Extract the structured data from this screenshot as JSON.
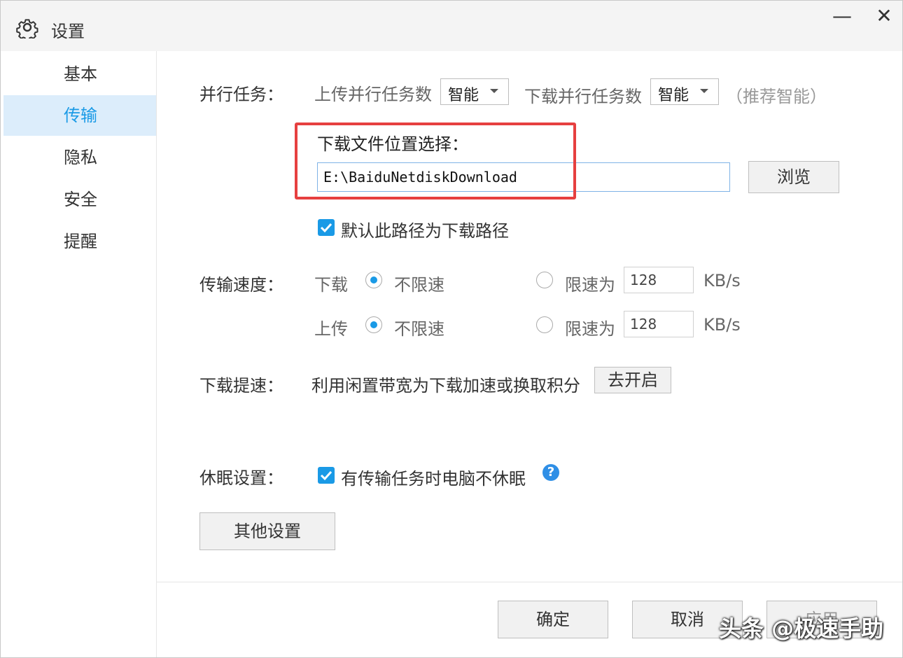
{
  "window": {
    "title": "设置",
    "minimize": "—",
    "close": "✕"
  },
  "sidebar": {
    "items": [
      {
        "label": "基本"
      },
      {
        "label": "传输",
        "active": true
      },
      {
        "label": "隐私"
      },
      {
        "label": "安全"
      },
      {
        "label": "提醒"
      }
    ]
  },
  "parallel": {
    "label": "并行任务：",
    "upload_label": "上传并行任务数",
    "upload_value": "智能",
    "download_label": "下载并行任务数",
    "download_value": "智能",
    "hint": "（推荐智能）"
  },
  "download_location": {
    "label": "下载文件位置选择：",
    "path": "E:\\BaiduNetdiskDownload",
    "browse": "浏览",
    "default_checkbox": "默认此路径为下载路径",
    "default_checked": true
  },
  "speed": {
    "label": "传输速度：",
    "download": {
      "label": "下载",
      "unlimited": "不限速",
      "limit": "限速为",
      "value": "128",
      "unit": "KB/s"
    },
    "upload": {
      "label": "上传",
      "unlimited": "不限速",
      "limit": "限速为",
      "value": "128",
      "unit": "KB/s"
    }
  },
  "boost": {
    "label": "下载提速：",
    "desc": "利用闲置带宽为下载加速或换取积分",
    "button": "去开启"
  },
  "sleep": {
    "label": "休眠设置：",
    "checkbox": "有传输任务时电脑不休眠",
    "checked": true,
    "help": "?"
  },
  "other_button": "其他设置",
  "footer": {
    "ok": "确定",
    "cancel": "取消",
    "apply": "应用"
  },
  "watermark": "头条 @极速手助",
  "colors": {
    "accent": "#1a9ae6",
    "highlight": "#e64040"
  }
}
